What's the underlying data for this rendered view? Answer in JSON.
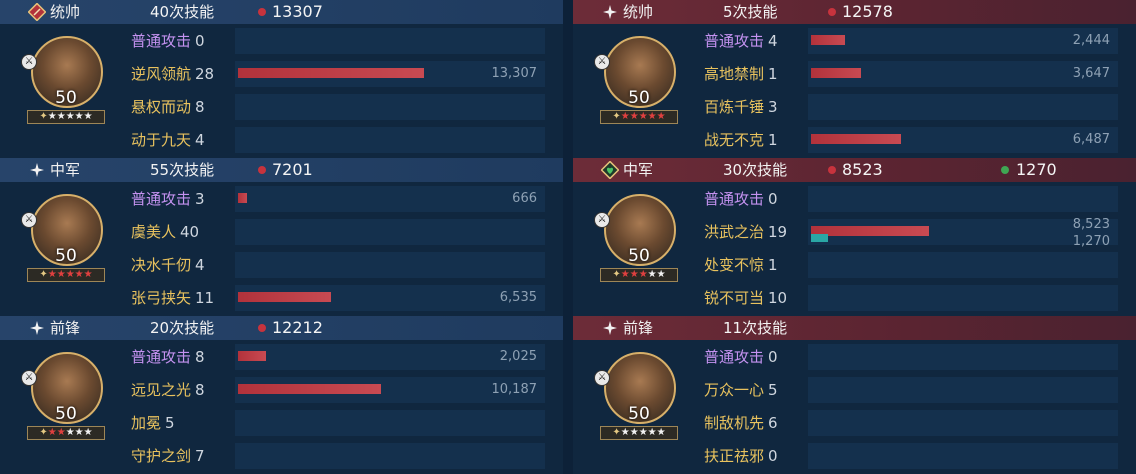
{
  "colors": {
    "damage_dot": "#c7333d",
    "heal_dot": "#3fa653",
    "bar": "#b2323b",
    "heal_bar": "#2aa7a5",
    "basic_skill": "#c492f0",
    "skill": "#e8c25e"
  },
  "left": [
    {
      "role": "统帅",
      "role_icon": "diamond-badge-icon",
      "count": "40次技能",
      "damage": "13307",
      "level": "50",
      "stars_red": 0,
      "stars_white": 5,
      "badge": "sword-icon",
      "skills": [
        {
          "name": "普通攻击",
          "level": "0",
          "basic": true,
          "value": null,
          "fraction": 0
        },
        {
          "name": "逆风领航",
          "level": "28",
          "basic": false,
          "value": "13,307",
          "fraction": 0.6
        },
        {
          "name": "悬权而动",
          "level": "8",
          "basic": false,
          "value": null,
          "fraction": 0
        },
        {
          "name": "动于九天",
          "level": "4",
          "basic": false,
          "value": null,
          "fraction": 0
        }
      ]
    },
    {
      "role": "中军",
      "role_icon": "sparkle-icon",
      "count": "55次技能",
      "damage": "7201",
      "level": "50",
      "stars_red": 5,
      "stars_white": 0,
      "badge": "cavalry-icon",
      "skills": [
        {
          "name": "普通攻击",
          "level": "3",
          "basic": true,
          "value": "666",
          "fraction": 0.03
        },
        {
          "name": "虞美人",
          "level": "40",
          "basic": false,
          "value": null,
          "fraction": 0
        },
        {
          "name": "决水千仞",
          "level": "4",
          "basic": false,
          "value": null,
          "fraction": 0
        },
        {
          "name": "张弓挟矢",
          "level": "11",
          "basic": false,
          "value": "6,535",
          "fraction": 0.3
        }
      ]
    },
    {
      "role": "前锋",
      "role_icon": "sparkle-icon",
      "count": "20次技能",
      "damage": "12212",
      "level": "50",
      "stars_red": 2,
      "stars_white": 3,
      "badge": "chariot-icon",
      "skills": [
        {
          "name": "普通攻击",
          "level": "8",
          "basic": true,
          "value": "2,025",
          "fraction": 0.09
        },
        {
          "name": "远见之光",
          "level": "8",
          "basic": false,
          "value": "10,187",
          "fraction": 0.46
        },
        {
          "name": "加冕",
          "level": "5",
          "basic": false,
          "value": null,
          "fraction": 0
        },
        {
          "name": "守护之剑",
          "level": "7",
          "basic": false,
          "value": null,
          "fraction": 0
        }
      ]
    }
  ],
  "right": [
    {
      "role": "统帅",
      "role_icon": "sparkle-icon",
      "count": "5次技能",
      "damage": "12578",
      "level": "50",
      "stars_red": 5,
      "stars_white": 0,
      "badge": "ship-icon",
      "skills": [
        {
          "name": "普通攻击",
          "level": "4",
          "basic": true,
          "value": "2,444",
          "fraction": 0.11
        },
        {
          "name": "高地禁制",
          "level": "1",
          "basic": false,
          "value": "3,647",
          "fraction": 0.16
        },
        {
          "name": "百炼千锤",
          "level": "3",
          "basic": false,
          "value": null,
          "fraction": 0
        },
        {
          "name": "战无不克",
          "level": "1",
          "basic": false,
          "value": "6,487",
          "fraction": 0.29
        }
      ]
    },
    {
      "role": "中军",
      "role_icon": "heart-badge-icon",
      "count": "30次技能",
      "damage": "8523",
      "heal": "1270",
      "level": "50",
      "stars_red": 3,
      "stars_white": 2,
      "badge": "sword-icon",
      "skills": [
        {
          "name": "普通攻击",
          "level": "0",
          "basic": true,
          "value": null,
          "fraction": 0
        },
        {
          "name": "洪武之治",
          "level": "19",
          "basic": false,
          "value": "8,523",
          "value2": "1,270",
          "fraction": 0.38,
          "heal_fraction": 0.055
        },
        {
          "name": "处变不惊",
          "level": "1",
          "basic": false,
          "value": null,
          "fraction": 0
        },
        {
          "name": "锐不可当",
          "level": "10",
          "basic": false,
          "value": null,
          "fraction": 0
        }
      ]
    },
    {
      "role": "前锋",
      "role_icon": "sparkle-icon",
      "count": "11次技能",
      "level": "50",
      "stars_red": 0,
      "stars_white": 5,
      "badge": "chariot-icon",
      "skills": [
        {
          "name": "普通攻击",
          "level": "0",
          "basic": true,
          "value": null,
          "fraction": 0
        },
        {
          "name": "万众一心",
          "level": "5",
          "basic": false,
          "value": null,
          "fraction": 0
        },
        {
          "name": "制敌机先",
          "level": "6",
          "basic": false,
          "value": null,
          "fraction": 0
        },
        {
          "name": "扶正祛邪",
          "level": "0",
          "basic": false,
          "value": null,
          "fraction": 0
        }
      ]
    }
  ]
}
